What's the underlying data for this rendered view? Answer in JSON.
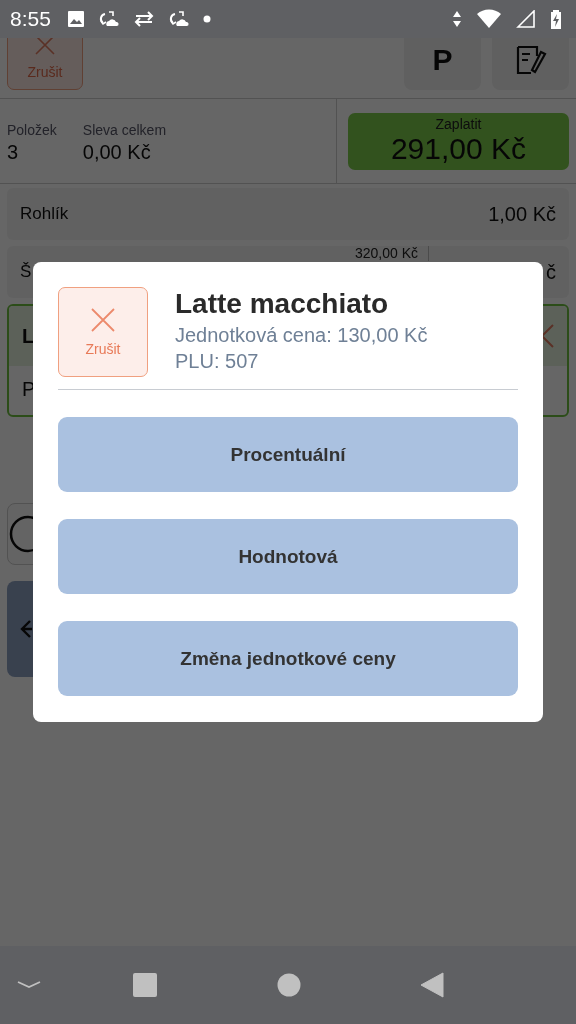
{
  "status_bar": {
    "time": "8:55"
  },
  "toolbar": {
    "cancel_label": "Zrušit",
    "park_label": "P"
  },
  "summary": {
    "items_label": "Položek",
    "items_count": "3",
    "discount_label": "Sleva celkem",
    "discount_value": "0,00 Kč",
    "pay_label": "Zaplatit",
    "pay_amount": "291,00 Kč"
  },
  "order_lines": [
    {
      "name": "Rohlík",
      "price": "1,00 Kč",
      "selected": false
    },
    {
      "name": "Š",
      "original_price": "320,00 Kč",
      "price": "č",
      "selected": false
    },
    {
      "name": "L",
      "detail": "P",
      "selected": true
    }
  ],
  "dialog": {
    "cancel_label": "Zrušit",
    "title": "Latte macchiato",
    "unit_price": "Jednotková cena: 130,00 Kč",
    "plu": "PLU: 507",
    "options": [
      "Procentuální",
      "Hodnotová",
      "Změna jednotkové ceny"
    ]
  }
}
